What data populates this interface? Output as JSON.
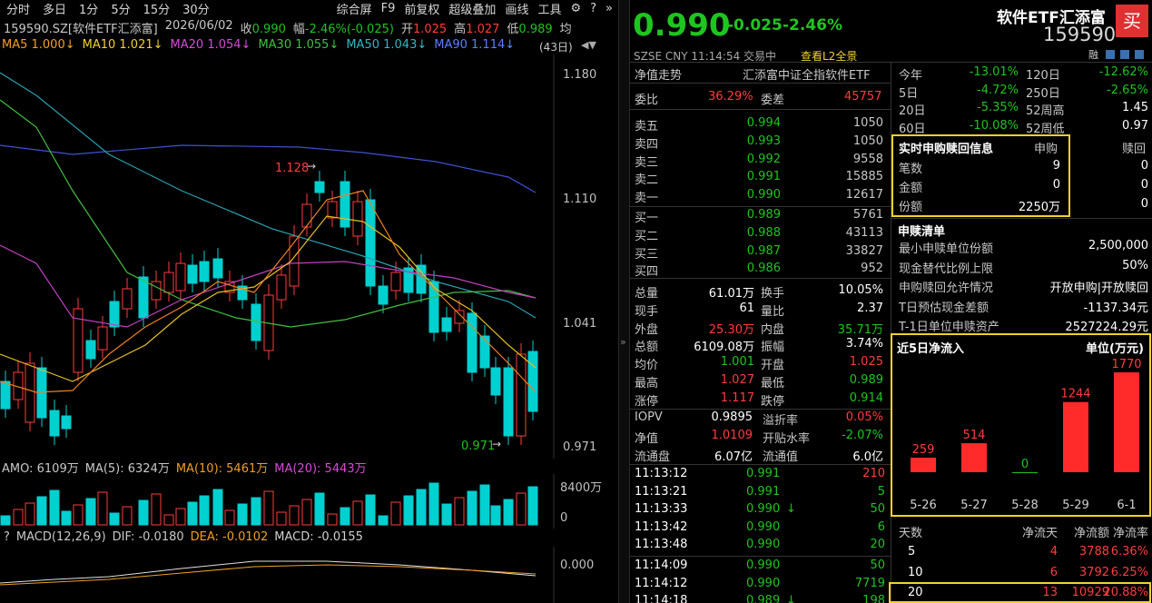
{
  "toolbar": {
    "items": [
      "分时",
      "多日",
      "1分",
      "5分",
      "15分",
      "30分"
    ],
    "right": [
      "综合屏",
      "F9",
      "前复权",
      "超级叠加",
      "画线",
      "工具"
    ],
    "icons": [
      "gear-icon",
      "help-icon",
      "forward-icon"
    ]
  },
  "info": {
    "code": "159590.SZ[软件ETF汇添富]",
    "date": "2026/06/02",
    "close_l": "收",
    "close": "0.990",
    "chg_l": "幅",
    "chg": "-2.46%(-0.025)",
    "open_l": "开",
    "open": "1.025",
    "high_l": "高",
    "high": "1.027",
    "low_l": "低",
    "low": "0.989",
    "avg_l": "均"
  },
  "ma": {
    "ma5": "MA5 1.000↓",
    "ma10": "MA10 1.021↓",
    "ma20": "MA20 1.054↓",
    "ma30": "MA30 1.055↓",
    "ma50": "MA50 1.043↓",
    "ma90": "MA90 1.114↓",
    "days": "(43日)"
  },
  "price_axis": {
    "p1": "1.180",
    "p2": "1.110",
    "p3": "1.041",
    "p4": "0.971"
  },
  "annot": {
    "high": "1.128",
    "low": "0.971"
  },
  "amo": {
    "a": "AMO: 6109万",
    "b": "MA(5): 6324万",
    "c": "MA(10): 5461万",
    "d": "MA(20): 5443万",
    "axis_top": "8400万",
    "axis_zero": "0"
  },
  "macd": {
    "q": "?",
    "a": "MACD(12,26,9)",
    "b": "DIF: -0.0180",
    "c": "DEA: -0.0102",
    "d": "MACD: -0.0155",
    "axis": "0.000"
  },
  "header": {
    "price": "0.990",
    "chg": "-0.025",
    "pct": "-2.46%",
    "name": "软件ETF汇添富",
    "code": "159590",
    "buy": "买",
    "sub": "SZSE  CNY  11:14:54  交易中",
    "l2": "查看L2全景",
    "rong": "融"
  },
  "nav": {
    "label": "净值走势",
    "index": "汇添富中证全指软件ETF"
  },
  "weibi": {
    "l1": "委比",
    "v1": "36.29%",
    "l2": "委差",
    "v2": "45757"
  },
  "asks": [
    [
      "卖五",
      "0.994",
      "1050"
    ],
    [
      "卖四",
      "0.993",
      "1050"
    ],
    [
      "卖三",
      "0.992",
      "9558"
    ],
    [
      "卖二",
      "0.991",
      "15885"
    ],
    [
      "卖一",
      "0.990",
      "12617"
    ]
  ],
  "bids": [
    [
      "买一",
      "0.989",
      "5761"
    ],
    [
      "买二",
      "0.988",
      "43113"
    ],
    [
      "买三",
      "0.987",
      "33827"
    ],
    [
      "买四",
      "0.986",
      "952"
    ]
  ],
  "stats": [
    [
      "总量",
      "61.01万",
      "换手",
      "10.05%"
    ],
    [
      "现手",
      "61",
      "量比",
      "2.37"
    ],
    [
      "外盘",
      "25.30万",
      "内盘",
      "35.71万"
    ],
    [
      "总额",
      "6109.08万",
      "振幅",
      "3.74%"
    ],
    [
      "均价",
      "1.001",
      "开盘",
      "1.025"
    ],
    [
      "最高",
      "1.027",
      "最低",
      "0.989"
    ],
    [
      "涨停",
      "1.117",
      "跌停",
      "0.914"
    ]
  ],
  "iopv": [
    [
      "IOPV",
      "0.9895",
      "溢折率",
      "0.05%"
    ],
    [
      "净值",
      "1.0109",
      "开贴水率",
      "-2.07%"
    ],
    [
      "流通盘",
      "6.07亿",
      "流通值",
      "6.0亿"
    ]
  ],
  "ticks": [
    [
      "11:13:12",
      "0.991",
      "",
      "210"
    ],
    [
      "11:13:21",
      "0.991",
      "",
      "5"
    ],
    [
      "11:13:33",
      "0.990",
      "↓",
      "50"
    ],
    [
      "11:13:42",
      "0.990",
      "",
      "6"
    ],
    [
      "11:13:48",
      "0.990",
      "",
      "20"
    ],
    [
      "11:14:09",
      "0.990",
      "",
      "50"
    ],
    [
      "11:14:12",
      "0.990",
      "",
      "7719"
    ],
    [
      "11:14:18",
      "0.989",
      "↓",
      "198"
    ]
  ],
  "returns": [
    [
      "今年",
      "-13.01%",
      "120日",
      "-12.62%"
    ],
    [
      "5日",
      "-4.72%",
      "250日",
      "-2.65%"
    ],
    [
      "20日",
      "-5.35%",
      "52周高",
      "1.45"
    ],
    [
      "60日",
      "-10.08%",
      "52周低",
      "0.97"
    ]
  ],
  "subs": {
    "title": "实时申购赎回信息",
    "h1": "申购",
    "h2": "赎回",
    "rows": [
      [
        "笔数",
        "9",
        "0"
      ],
      [
        "金额",
        "0",
        "0"
      ],
      [
        "份额",
        "2250万",
        "0"
      ]
    ]
  },
  "list": {
    "title": "申赎清单",
    "rows": [
      [
        "最小申赎单位份额",
        "2,500,000"
      ],
      [
        "现金替代比例上限",
        "50%"
      ],
      [
        "申购赎回允许情况",
        "开放申购|开放赎回"
      ],
      [
        "T日预估现金差额",
        "-1137.34元"
      ],
      [
        "T-1日单位申赎资产",
        "2527224.29元"
      ]
    ]
  },
  "chart_data": {
    "type": "bar",
    "title": "近5日净流入",
    "ylabel": "单位(万元)",
    "categories": [
      "5-26",
      "5-27",
      "5-28",
      "5-29",
      "6-1"
    ],
    "values": [
      259,
      514,
      0,
      1244,
      1770
    ]
  },
  "flow": {
    "h": [
      "天数",
      "净流天",
      "净流额",
      "净流率"
    ],
    "rows": [
      [
        "5",
        "4",
        "3788",
        "6.36%"
      ],
      [
        "10",
        "6",
        "3792",
        "6.25%"
      ],
      [
        "20",
        "13",
        "10929",
        "20.88%"
      ]
    ]
  },
  "colors": {
    "up": "#ff3c3c",
    "down": "#1ec51e",
    "accent": "#f2d22b",
    "cyan": "#00d0d0"
  }
}
